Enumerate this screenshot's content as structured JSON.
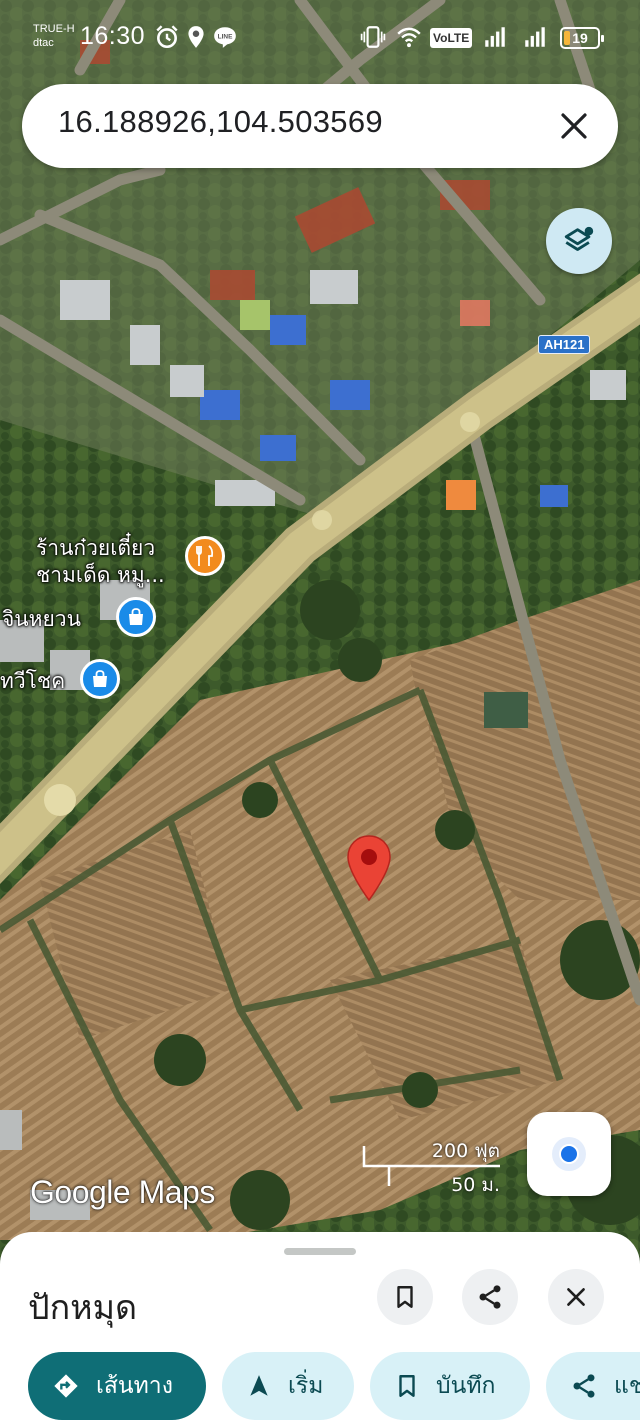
{
  "status_bar": {
    "carrier_1": "TRUE-H",
    "carrier_2": "dtac",
    "time": "16:30",
    "notification_icons": [
      "alarm-icon",
      "location-icon",
      "line-app-icon"
    ],
    "volte_label": "VoLTE",
    "battery_level": "19",
    "battery_color": "#f5b63a"
  },
  "search": {
    "query": "16.188926,104.503569",
    "close_icon": "close-icon"
  },
  "map": {
    "road_shield": "AH121",
    "pois": [
      {
        "label_line1": "ร้านก๋วยเตี๋ยว",
        "label_line2": "ชามเด็ด หมู...",
        "icon": "restaurant-icon",
        "color": "#f28b1e"
      },
      {
        "label_line1": "จินหยวน",
        "icon": "shopping-bag-icon",
        "color": "#1a8be8"
      },
      {
        "label_line1": "ทวีโชค",
        "icon": "shopping-bag-icon",
        "color": "#1a8be8"
      }
    ],
    "pin_color": "#ea4335",
    "scale_top": "200 ฟุต",
    "scale_bottom": "50 ม.",
    "watermark": "Google Maps"
  },
  "sheet": {
    "title": "ปักหมุด",
    "actions": {
      "save_icon": "bookmark-icon",
      "share_icon": "share-icon",
      "close_icon": "close-icon"
    },
    "chips": [
      {
        "label": "เส้นทาง",
        "icon": "directions-icon",
        "primary": true
      },
      {
        "label": "เริ่ม",
        "icon": "navigate-icon",
        "primary": false
      },
      {
        "label": "บันทึก",
        "icon": "bookmark-icon",
        "primary": false
      },
      {
        "label": "แช",
        "icon": "share-icon",
        "primary": false
      }
    ],
    "accent_color": "#0f6e76",
    "chip_color": "#d8f1f7"
  }
}
